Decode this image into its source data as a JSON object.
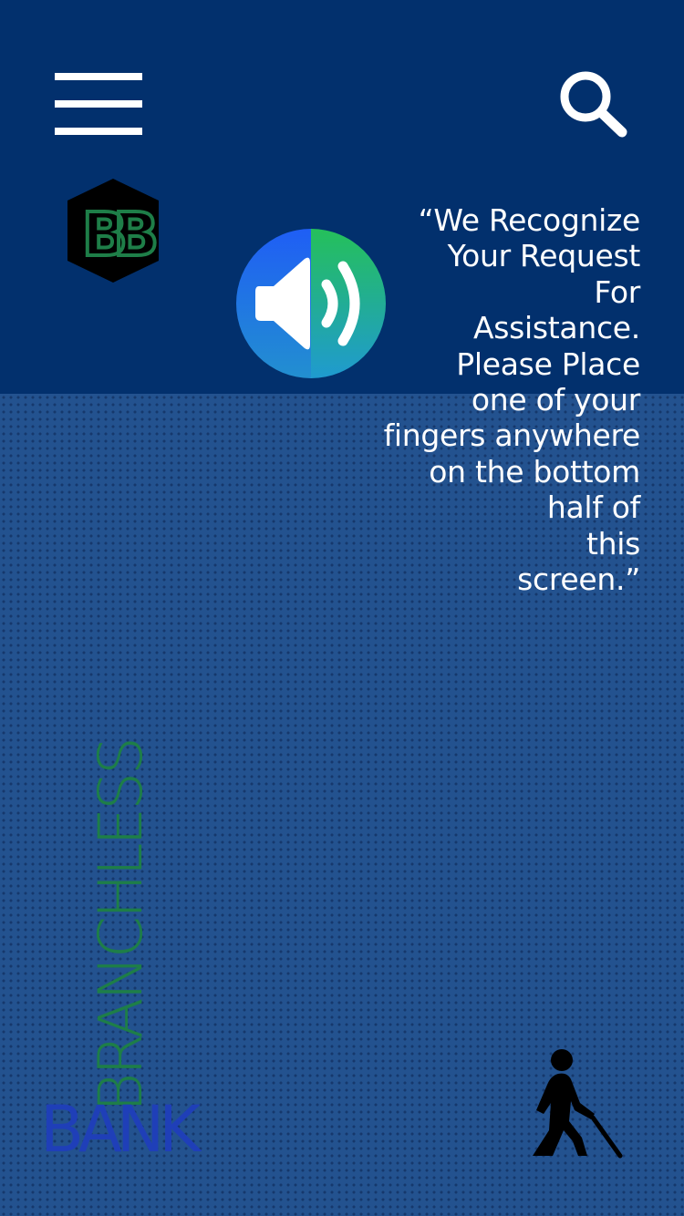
{
  "header": {
    "menu_icon": "hamburger-menu-icon",
    "search_icon": "magnifier-icon"
  },
  "logo": {
    "text": "BB",
    "icon": "hexagon-bb-logo",
    "color": "#1e7e48"
  },
  "speaker": {
    "icon": "speaker-volume-icon",
    "colors": [
      "#2266f0",
      "#2bb35a"
    ]
  },
  "assistance_message": {
    "lines": [
      "“We Recognize",
      "Your Request",
      "For",
      "Assistance.",
      "Please Place",
      "one of your",
      "fingers anywhere",
      "on the bottom",
      "half of",
      "this",
      "screen.”"
    ]
  },
  "brand": {
    "line1": "BRANCHLESS",
    "line2": "BANK",
    "line1_color": "#1e7e48",
    "line2_color": "#1f3fb8"
  },
  "accessibility": {
    "icon": "blind-person-walking-cane-icon"
  },
  "colors": {
    "top_background": "#02306d",
    "bottom_background": "#23528f"
  }
}
